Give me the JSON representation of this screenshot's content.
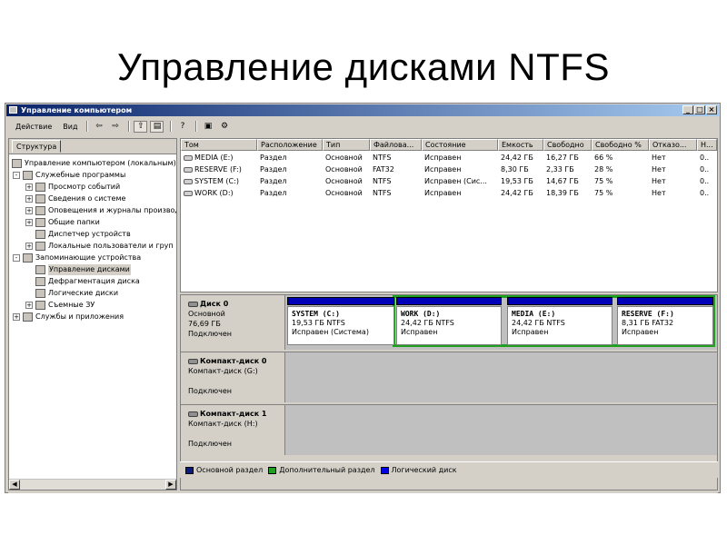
{
  "slide": {
    "title": "Управление дисками NTFS"
  },
  "window": {
    "title": "Управление компьютером",
    "controls": [
      "_",
      "□",
      "×"
    ]
  },
  "menu": {
    "action": "Действие",
    "view": "Вид"
  },
  "left_pane": {
    "tab": "Структура",
    "tree": [
      {
        "label": "Управление компьютером (локальным)",
        "level": 0,
        "expander": "",
        "icon": "computer-icon"
      },
      {
        "label": "Служебные программы",
        "level": 1,
        "expander": "-",
        "icon": "tools-icon"
      },
      {
        "label": "Просмотр событий",
        "level": 2,
        "expander": "+",
        "icon": "event-viewer-icon"
      },
      {
        "label": "Сведения о системе",
        "level": 2,
        "expander": "+",
        "icon": "system-info-icon"
      },
      {
        "label": "Оповещения и журналы производ",
        "level": 2,
        "expander": "+",
        "icon": "alerts-icon"
      },
      {
        "label": "Общие папки",
        "level": 2,
        "expander": "+",
        "icon": "shared-folder-icon"
      },
      {
        "label": "Диспетчер устройств",
        "level": 2,
        "expander": "",
        "icon": "device-manager-icon"
      },
      {
        "label": "Локальные пользователи и груп",
        "level": 2,
        "expander": "+",
        "icon": "users-icon"
      },
      {
        "label": "Запоминающие устройства",
        "level": 1,
        "expander": "-",
        "icon": "storage-icon"
      },
      {
        "label": "Управление дисками",
        "level": 2,
        "expander": "",
        "icon": "disk-management-icon",
        "selected": true
      },
      {
        "label": "Дефрагментация диска",
        "level": 2,
        "expander": "",
        "icon": "defrag-icon"
      },
      {
        "label": "Логические диски",
        "level": 2,
        "expander": "",
        "icon": "logical-drives-icon"
      },
      {
        "label": "Съемные ЗУ",
        "level": 2,
        "expander": "+",
        "icon": "removable-storage-icon"
      },
      {
        "label": "Службы и приложения",
        "level": 1,
        "expander": "+",
        "icon": "services-icon"
      }
    ]
  },
  "volume_list": {
    "columns": [
      "Том",
      "Расположение",
      "Тип",
      "Файлова...",
      "Состояние",
      "Емкость",
      "Свободно",
      "Свободно %",
      "Отказо...",
      "Н..."
    ],
    "rows": [
      [
        "MEDIA (E:)",
        "Раздел",
        "Основной",
        "NTFS",
        "Исправен",
        "24,42 ГБ",
        "16,27 ГБ",
        "66 %",
        "Нет",
        "0.."
      ],
      [
        "RESERVE (F:)",
        "Раздел",
        "Основной",
        "FAT32",
        "Исправен",
        "8,30 ГБ",
        "2,33 ГБ",
        "28 %",
        "Нет",
        "0.."
      ],
      [
        "SYSTEM (C:)",
        "Раздел",
        "Основной",
        "NTFS",
        "Исправен (Сис...",
        "19,53 ГБ",
        "14,67 ГБ",
        "75 %",
        "Нет",
        "0.."
      ],
      [
        "WORK (D:)",
        "Раздел",
        "Основной",
        "NTFS",
        "Исправен",
        "24,42 ГБ",
        "18,39 ГБ",
        "75 %",
        "Нет",
        "0.."
      ]
    ]
  },
  "disks": [
    {
      "name": "Диск 0",
      "lines": [
        "Основной",
        "76,69 ГБ",
        "Подключен"
      ],
      "partitions": [
        {
          "name": "SYSTEM  (C:)",
          "size": "19,53 ГБ NTFS",
          "status": "Исправен (Система)"
        },
        {
          "name": "WORK  (D:)",
          "size": "24,42 ГБ NTFS",
          "status": "Исправен"
        },
        {
          "name": "MEDIA  (E:)",
          "size": "24,42 ГБ NTFS",
          "status": "Исправен"
        },
        {
          "name": "RESERVE  (F:)",
          "size": "8,31 ГБ FAT32",
          "status": "Исправен"
        }
      ]
    },
    {
      "name": "Компакт-диск 0",
      "lines": [
        "Компакт-диск (G:)",
        "",
        "Подключен"
      ]
    },
    {
      "name": "Компакт-диск 1",
      "lines": [
        "Компакт-диск (H:)",
        "",
        "Подключен"
      ]
    }
  ],
  "legend": [
    {
      "label": "Основной раздел",
      "color": "#0a1a80"
    },
    {
      "label": "Дополнительный раздел",
      "color": "#20a020"
    },
    {
      "label": "Логический диск",
      "color": "#0000e0"
    }
  ]
}
